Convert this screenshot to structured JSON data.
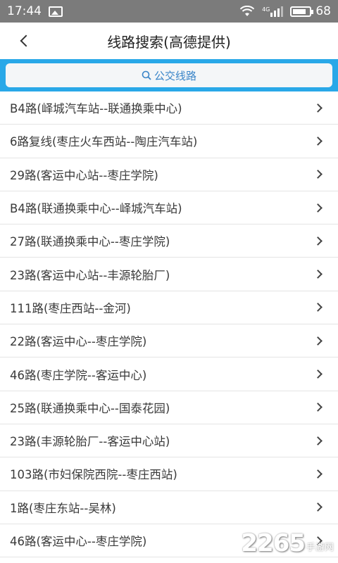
{
  "status_bar": {
    "time": "17:44",
    "network_label": "4G",
    "battery": "68"
  },
  "header": {
    "title": "线路搜索(高德提供)"
  },
  "search": {
    "label": "公交线路"
  },
  "routes": [
    "B4路(峄城汽车站--联通换乘中心)",
    "6路复线(枣庄火车西站--陶庄汽车站)",
    "29路(客运中心站--枣庄学院)",
    "B4路(联通换乘中心--峄城汽车站)",
    "27路(联通换乘中心--枣庄学院)",
    "23路(客运中心站--丰源轮胎厂)",
    "111路(枣庄西站--金河)",
    "22路(客运中心--枣庄学院)",
    "46路(枣庄学院--客运中心)",
    "25路(联通换乘中心--国泰花园)",
    "23路(丰源轮胎厂--客运中心站)",
    "103路(市妇保院西院--枣庄西站)",
    "1路(枣庄东站--吴林)",
    "46路(客运中心--枣庄学院)"
  ],
  "watermark": {
    "number": "2265",
    "text": "手游网"
  },
  "colors": {
    "accent": "#29a8e8",
    "status_bar": "#7b7b7b"
  }
}
